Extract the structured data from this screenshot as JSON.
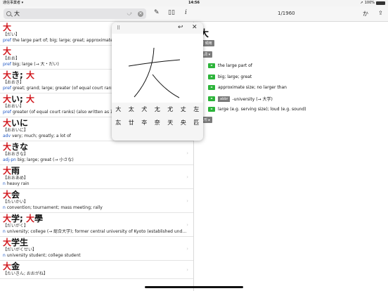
{
  "status": {
    "carrier": "通信事業者 ▾",
    "time": "14:56",
    "battery": "100%"
  },
  "toolbar": {
    "search_value": "大",
    "arrow": "⤻",
    "page_counter": "1/1960",
    "kana_label": "か",
    "icons": [
      "search-icon",
      "clear-icon",
      "pen-icon",
      "book-icon",
      "info-icon",
      "share-icon"
    ]
  },
  "entries": [
    {
      "head": [
        [
          "大",
          true
        ]
      ],
      "reading": "【だい】",
      "pos": "pref",
      "def": "the large part of; big; large; great; approximate size"
    },
    {
      "head": [
        [
          "大",
          true
        ]
      ],
      "reading": "【おお】",
      "pos": "pref",
      "def": "big; large (→ 大・だい)"
    },
    {
      "head": [
        [
          "大",
          true
        ],
        [
          "き; ",
          false
        ],
        [
          "大",
          true
        ]
      ],
      "reading": "【おおき】",
      "pos": "pref",
      "def": "great; grand; large; greater (of equal court ranks) (a"
    },
    {
      "head": [
        [
          "大",
          true
        ],
        [
          "い; ",
          false
        ],
        [
          "大",
          true
        ]
      ],
      "reading": "【おおい】",
      "pos": "pref",
      "def": "greater (of equal court ranks) (also written as 正); sen"
    },
    {
      "head": [
        [
          "大",
          true
        ],
        [
          "いに",
          false
        ]
      ],
      "reading": "【おおいに】",
      "pos": "adv",
      "def": "very; much; greatly; a lot of"
    },
    {
      "head": [
        [
          "大",
          true
        ],
        [
          "きな",
          false
        ]
      ],
      "reading": "【おおきな】",
      "pos": "adj-pn",
      "def": "big; large; great (→ 小さな)"
    },
    {
      "head": [
        [
          "大",
          true
        ],
        [
          "雨",
          false
        ]
      ],
      "reading": "【おおあめ】",
      "pos": "n",
      "def": "heavy rain"
    },
    {
      "head": [
        [
          "大",
          true
        ],
        [
          "会",
          false
        ]
      ],
      "reading": "【たいかい】",
      "pos": "n",
      "def": "convention; tournament; mass meeting; rally"
    },
    {
      "head": [
        [
          "大",
          true
        ],
        [
          "学; ",
          false
        ],
        [
          "大",
          true
        ],
        [
          "學",
          false
        ]
      ],
      "reading": "【だいがく】",
      "pos": "n",
      "def": "university; college (→ 総合大学); former central university of Kyoto (established under the..."
    },
    {
      "head": [
        [
          "大",
          true
        ],
        [
          "学生",
          false
        ]
      ],
      "reading": "【だいがくせい】",
      "pos": "n",
      "def": "university student; college student"
    },
    {
      "head": [
        [
          "大",
          true
        ],
        [
          "金",
          false
        ]
      ],
      "reading": "【たいきん; おおがね】",
      "pos": "",
      "def": ""
    }
  ],
  "detail": {
    "kanji": "大",
    "tag1": "常 頻用",
    "tag2": "名詞 ▾",
    "senses": [
      {
        "text": "the large part of",
        "abbr": ""
      },
      {
        "text": "big; large; great",
        "abbr": ""
      },
      {
        "text": "approximate size; no larger than",
        "abbr": ""
      },
      {
        "text": "-university (→ 大学)",
        "abbr": "abbr"
      },
      {
        "text": "large (e.g. serving size); loud (e.g. sound)",
        "abbr": ""
      }
    ],
    "tag3": "…形 ▸"
  },
  "popover": {
    "grid_icon": "⠿",
    "undo_icon": "↩",
    "close_icon": "✕",
    "candidates": [
      [
        "大",
        "太",
        "犬",
        "尢",
        "尤",
        "丈",
        "左"
      ],
      [
        "厷",
        "廿",
        "夲",
        "奈",
        "天",
        "央",
        "匹"
      ]
    ]
  }
}
